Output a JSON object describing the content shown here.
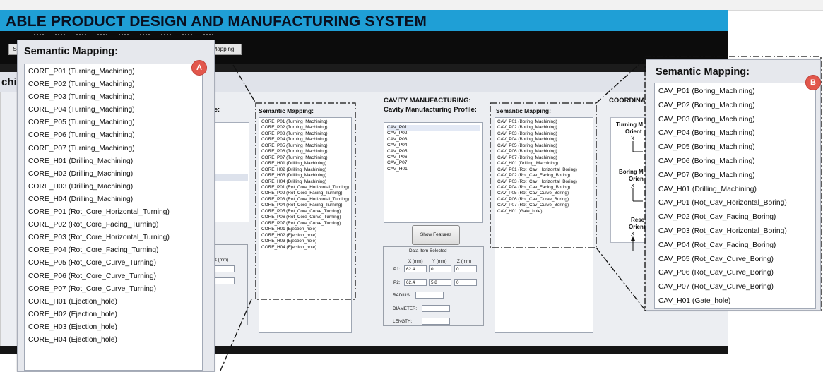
{
  "app": {
    "title": "ABLE PRODUCT DESIGN AND MANUFACTURING SYSTEM",
    "menu": [
      "Sc",
      "Mapping"
    ],
    "tab_fragment": "chi",
    "brand_color": "#1f9fd6"
  },
  "core_panel": {
    "heading_fragment": "G:",
    "subheading_fragment": "efile:",
    "coord_header": "Z (mm)"
  },
  "core_semantic_small": {
    "title": "Semantic Mapping:",
    "items": [
      "CORE_P01 (Turning_Machining)",
      "CORE_P02 (Turning_Machining)",
      "CORE_P03 (Turning_Machining)",
      "CORE_P04 (Turning_Machining)",
      "CORE_P05 (Turning_Machining)",
      "CORE_P06 (Turning_Machining)",
      "CORE_P07 (Turning_Machining)",
      "CORE_H01 (Drilling_Machining)",
      "CORE_H02 (Drilling_Machining)",
      "CORE_H03 (Drilling_Machining)",
      "CORE_H04 (Drilling_Machining)",
      "CORE_P01 (Rot_Core_Horizontal_Turning)",
      "CORE_P02 (Rot_Core_Facing_Turning)",
      "CORE_P03 (Rot_Core_Horizontal_Turning)",
      "CORE_P04 (Rot_Core_Facing_Turning)",
      "CORE_P05 (Rot_Core_Curve_Turning)",
      "CORE_P06 (Rot_Core_Curve_Turning)",
      "CORE_P07 (Rot_Core_Curve_Turning)",
      "CORE_H01 (Ejection_hole)",
      "CORE_H02 (Ejection_hole)",
      "CORE_H03 (Ejection_hole)",
      "CORE_H04 (Ejection_hole)"
    ]
  },
  "cavity": {
    "heading": "CAVITY MANUFACTURING:",
    "subheading": "Cavity Manufacturing Profile:",
    "profile": [
      "CAV_P01",
      "CAV_P02",
      "CAV_P03",
      "CAV_P04",
      "CAV_P05",
      "CAV_P06",
      "CAV_P07",
      "CAV_H01"
    ],
    "show_button": "Show Features",
    "data_item": {
      "title": "Data Item Selected",
      "x_header": "X (mm)",
      "y_header": "Y (mm)",
      "z_header": "Z (mm)",
      "p1_label": "P1:",
      "p1": [
        "62.4",
        "0",
        "0"
      ],
      "p2_label": "P2:",
      "p2": [
        "62.4",
        "5.8",
        "0"
      ],
      "radius_label": "RADIUS:",
      "diameter_label": "DIAMETER:",
      "length_label": "LENGTH:"
    }
  },
  "cavity_semantic_small": {
    "title": "Semantic Mapping:",
    "items": [
      "CAV_P01 (Boring_Machining)",
      "CAV_P02 (Boring_Machining)",
      "CAV_P03 (Boring_Machining)",
      "CAV_P04 (Boring_Machining)",
      "CAV_P05 (Boring_Machining)",
      "CAV_P06 (Boring_Machining)",
      "CAV_P07 (Boring_Machining)",
      "CAV_H01 (Drilling_Machining)",
      "CAV_P01 (Rot_Cav_Horizontal_Boring)",
      "CAV_P02 (Rot_Cav_Facing_Boring)",
      "CAV_P03 (Rot_Cav_Horizontal_Boring)",
      "CAV_P04 (Rot_Cav_Facing_Boring)",
      "CAV_P05 (Rot_Cav_Curve_Boring)",
      "CAV_P06 (Rot_Cav_Curve_Boring)",
      "CAV_P07 (Rot_Cav_Curve_Boring)",
      "CAV_H01 (Gate_hole)"
    ]
  },
  "coordinate": {
    "heading_fragment": "COORDINA",
    "turning_1": "Turning M",
    "turning_2": "Orient",
    "boring_1": "Boring M",
    "boring_2": "Orien",
    "reset_1": "Rese",
    "reset_2": "Orient",
    "axis_x": "X"
  },
  "callout_a": {
    "badge": "A",
    "title": "Semantic Mapping:",
    "items": [
      "CORE_P01 (Turning_Machining)",
      "CORE_P02 (Turning_Machining)",
      "CORE_P03 (Turning_Machining)",
      "CORE_P04 (Turning_Machining)",
      "CORE_P05 (Turning_Machining)",
      "CORE_P06 (Turning_Machining)",
      "CORE_P07 (Turning_Machining)",
      "CORE_H01 (Drilling_Machining)",
      "CORE_H02 (Drilling_Machining)",
      "CORE_H03 (Drilling_Machining)",
      "CORE_H04 (Drilling_Machining)",
      "CORE_P01 (Rot_Core_Horizontal_Turning)",
      "CORE_P02 (Rot_Core_Facing_Turning)",
      "CORE_P03 (Rot_Core_Horizontal_Turning)",
      "CORE_P04 (Rot_Core_Facing_Turning)",
      "CORE_P05 (Rot_Core_Curve_Turning)",
      "CORE_P06 (Rot_Core_Curve_Turning)",
      "CORE_P07 (Rot_Core_Curve_Turning)",
      "CORE_H01 (Ejection_hole)",
      "CORE_H02 (Ejection_hole)",
      "CORE_H03 (Ejection_hole)",
      "CORE_H04 (Ejection_hole)"
    ]
  },
  "callout_b": {
    "badge": "B",
    "title": "Semantic Mapping:",
    "items": [
      "CAV_P01 (Boring_Machining)",
      "CAV_P02 (Boring_Machining)",
      "CAV_P03 (Boring_Machining)",
      "CAV_P04 (Boring_Machining)",
      "CAV_P05 (Boring_Machining)",
      "CAV_P06 (Boring_Machining)",
      "CAV_P07 (Boring_Machining)",
      "CAV_H01 (Drilling_Machining)",
      "CAV_P01 (Rot_Cav_Horizontal_Boring)",
      "CAV_P02 (Rot_Cav_Facing_Boring)",
      "CAV_P03 (Rot_Cav_Horizontal_Boring)",
      "CAV_P04 (Rot_Cav_Facing_Boring)",
      "CAV_P05 (Rot_Cav_Curve_Boring)",
      "CAV_P06 (Rot_Cav_Curve_Boring)",
      "CAV_P07 (Rot_Cav_Curve_Boring)",
      "CAV_H01 (Gate_hole)"
    ]
  }
}
